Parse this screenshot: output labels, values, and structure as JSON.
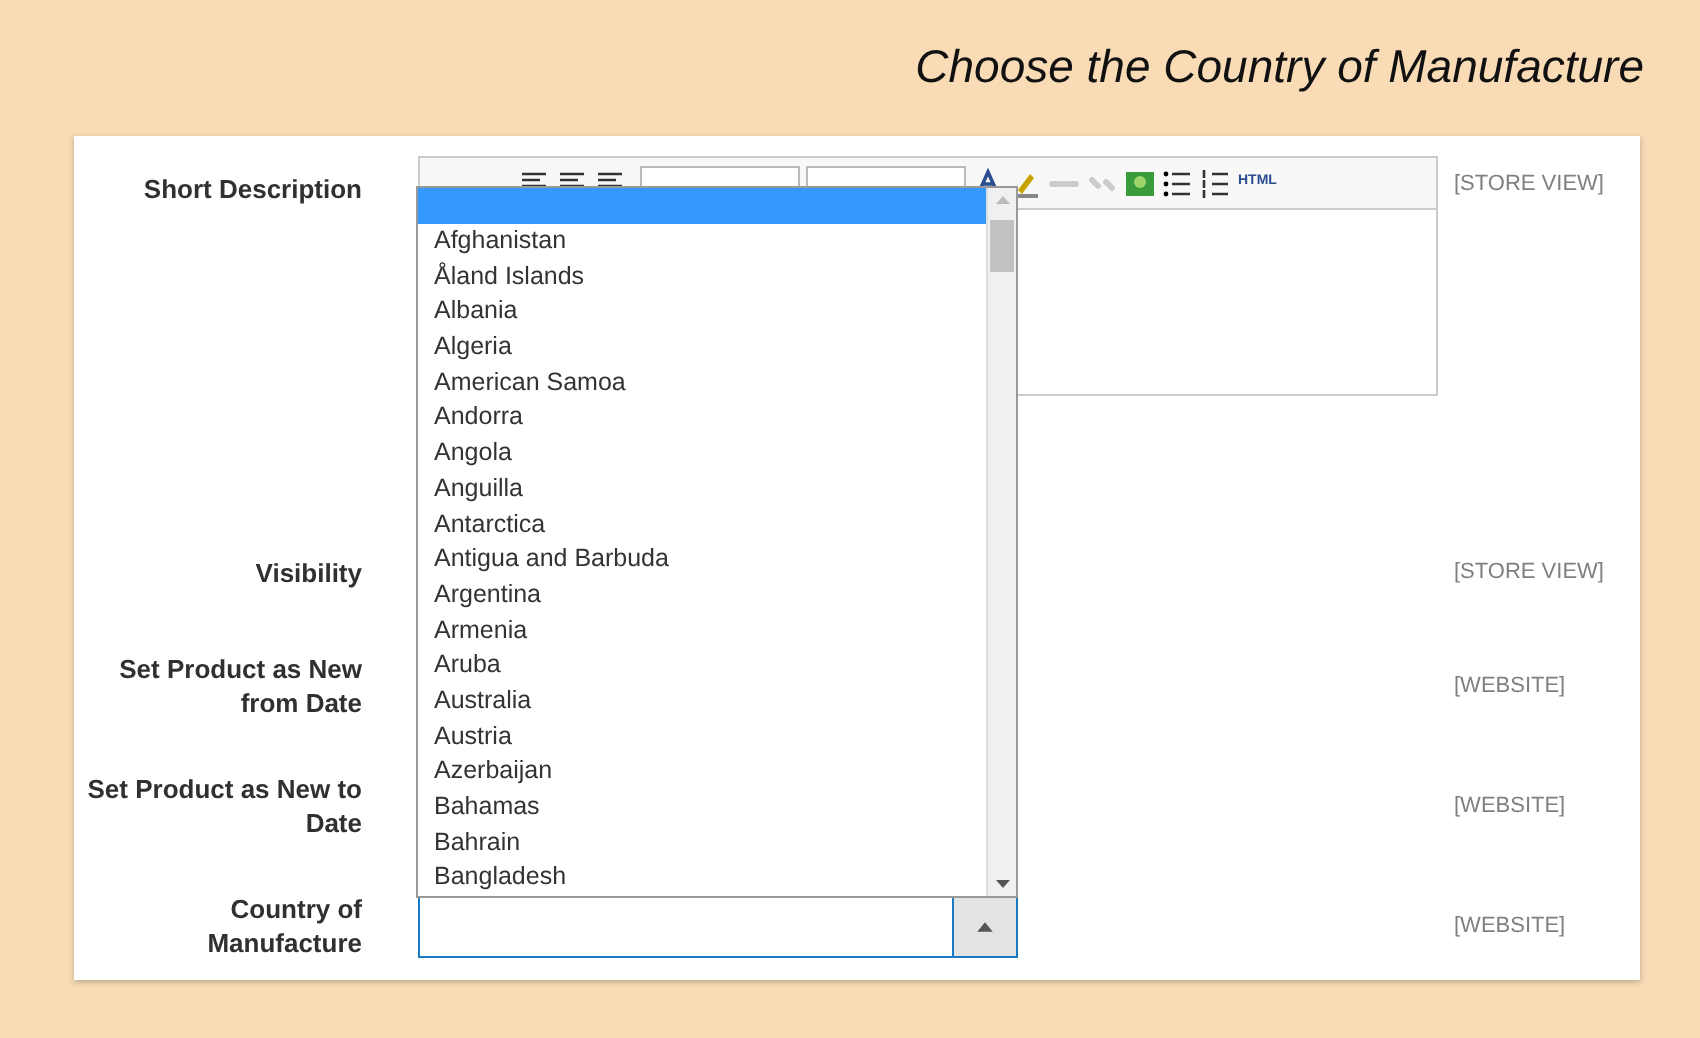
{
  "title": "Choose the Country of Manufacture",
  "editor_toolbar": {
    "html": "HTML"
  },
  "fields": [
    {
      "label": "Short Description",
      "scope": "[STORE VIEW]"
    },
    {
      "label": "Visibility",
      "scope": "[STORE VIEW]"
    },
    {
      "label": "Set Product as New from Date",
      "scope": "[WEBSITE]"
    },
    {
      "label": "Set Product as New to Date",
      "scope": "[WEBSITE]"
    },
    {
      "label": "Country of Manufacture",
      "scope": "[WEBSITE]"
    }
  ],
  "country_dropdown": {
    "expanded": true,
    "blank_option": {
      "selected": true
    },
    "options": [
      {
        "label": "Afghanistan",
        "selected": false
      },
      {
        "label": "Åland Islands",
        "selected": false
      },
      {
        "label": "Albania",
        "selected": false
      },
      {
        "label": "Algeria",
        "selected": false
      },
      {
        "label": "American Samoa",
        "selected": false
      },
      {
        "label": "Andorra",
        "selected": false
      },
      {
        "label": "Angola",
        "selected": false
      },
      {
        "label": "Anguilla",
        "selected": false
      },
      {
        "label": "Antarctica",
        "selected": false
      },
      {
        "label": "Antigua and Barbuda",
        "selected": false
      },
      {
        "label": "Argentina",
        "selected": false
      },
      {
        "label": "Armenia",
        "selected": false
      },
      {
        "label": "Aruba",
        "selected": false
      },
      {
        "label": "Australia",
        "selected": false
      },
      {
        "label": "Austria",
        "selected": false
      },
      {
        "label": "Azerbaijan",
        "selected": false
      },
      {
        "label": "Bahamas",
        "selected": false
      },
      {
        "label": "Bahrain",
        "selected": false
      },
      {
        "label": "Bangladesh",
        "selected": false
      }
    ]
  }
}
